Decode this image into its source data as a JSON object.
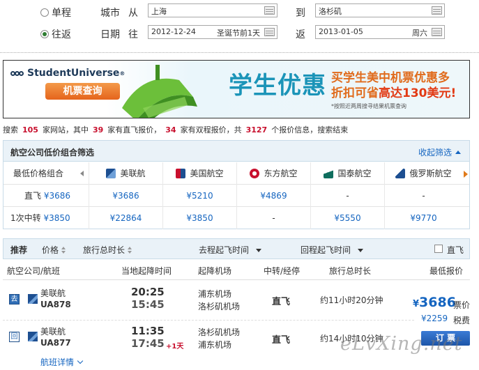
{
  "form": {
    "one_way_label": "单程",
    "round_trip_label": "往返",
    "city_label": "城市",
    "from_label": "从",
    "to_label": "到",
    "from_city": "上海",
    "to_city": "洛杉矶",
    "date_label": "日期",
    "depart_label": "往",
    "return_label": "返",
    "depart_date": "2012-12-24",
    "depart_note": "圣诞节前1天",
    "return_date": "2013-01-05",
    "return_note": "周六",
    "selected_trip": "round_trip"
  },
  "banner": {
    "brand": "StudentUniverse",
    "brand_reg": "®",
    "button": "机票查询",
    "headline": "学生优惠",
    "line1": "买学生美中机票优惠多",
    "line2_prefix": "折扣可省",
    "line2_highlight": "高达130美元!",
    "note": "*按照近两周搜寻结果机票查询"
  },
  "summary": {
    "p1": "搜索",
    "sites": "105",
    "p2": "家网站，其中",
    "direct_sites": "39",
    "p3": "家有直飞报价，",
    "roundtrip_sites": "34",
    "p4": "家有双程报价，共",
    "total": "3127",
    "p5": "个报价信息，搜索结束"
  },
  "filter": {
    "title": "航空公司低价组合筛选",
    "collapse": "收起筛选",
    "row_header": "最低价格组合",
    "airlines": [
      {
        "name": "美联航",
        "color": "#1d4f91"
      },
      {
        "name": "美国航空",
        "color": "#c8102e"
      },
      {
        "name": "东方航空",
        "color": "#c8102e"
      },
      {
        "name": "国泰航空",
        "color": "#0f6e5e"
      },
      {
        "name": "俄罗斯航空",
        "color": "#1d4f91"
      }
    ],
    "rows": [
      {
        "label": "直飞",
        "best": "¥3686",
        "prices": [
          "¥3686",
          "¥5210",
          "¥4869",
          "-",
          "-"
        ]
      },
      {
        "label": "1次中转",
        "best": "¥3850",
        "prices": [
          "¥22864",
          "¥3850",
          "-",
          "¥5550",
          "¥9770"
        ]
      }
    ]
  },
  "sortbar": {
    "recommend": "推荐",
    "price": "价格",
    "total_duration": "旅行总时长",
    "depart_time": "去程起飞时间",
    "return_time": "回程起飞时间",
    "direct": "直飞"
  },
  "columns": {
    "airline": "航空公司/航班",
    "local_time": "当地起降时间",
    "airport": "起降机场",
    "stop": "中转/经停",
    "duration": "旅行总时长",
    "price": "最低报价"
  },
  "flights": [
    {
      "badge": "去",
      "airline": "美联航",
      "code": "UA878",
      "dep": "20:25",
      "arr": "15:45",
      "plus": "",
      "dep_airport": "浦东机场",
      "arr_airport": "洛杉矶机场",
      "stop": "直飞",
      "duration": "约11小时20分钟"
    },
    {
      "badge": "回",
      "airline": "美联航",
      "code": "UA877",
      "dep": "11:35",
      "arr": "17:45",
      "plus": "+1天",
      "dep_airport": "洛杉矶机场",
      "arr_airport": "浦东机场",
      "stop": "直飞",
      "duration": "约14小时10分钟"
    }
  ],
  "offer": {
    "yen": "¥",
    "price": "3686",
    "price_unit": "票价",
    "tax": "¥2259",
    "tax_unit": "税费",
    "order": "订 票",
    "details": "航班详情"
  },
  "watermark": "eLvXing.net"
}
